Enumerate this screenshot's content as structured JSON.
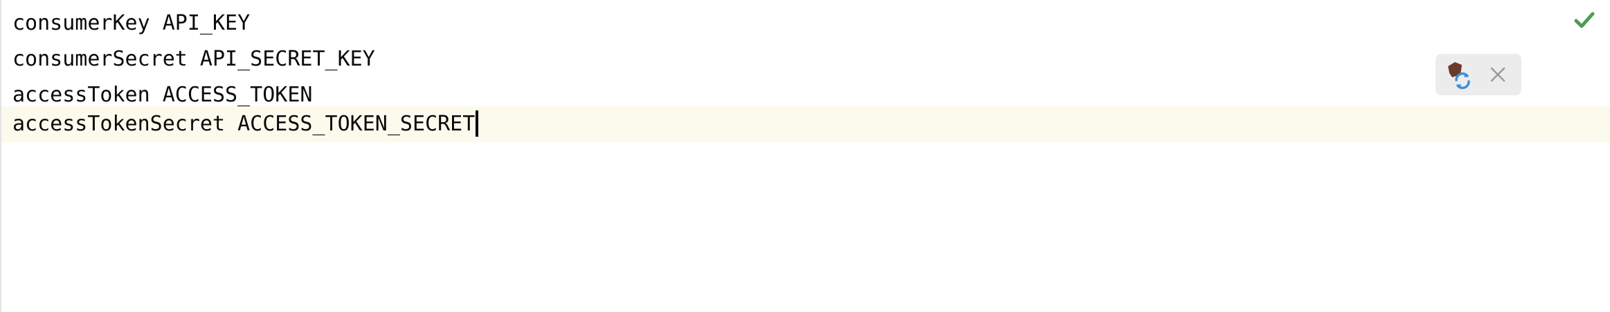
{
  "editor": {
    "lines": [
      "consumerKey API_KEY",
      "consumerSecret API_SECRET_KEY",
      "accessToken ACCESS_TOKEN",
      "accessTokenSecret ACCESS_TOKEN_SECRET"
    ]
  },
  "icons": {
    "status": "check-icon",
    "reload": "load-gradle-changes-icon",
    "close": "close-icon"
  },
  "colors": {
    "current_line_bg": "#fcfaed",
    "check_green": "#4e9a57",
    "toolbar_bg": "#ececec",
    "reload_blue": "#3d8fd9",
    "elephant_brown": "#6b3a2e"
  }
}
